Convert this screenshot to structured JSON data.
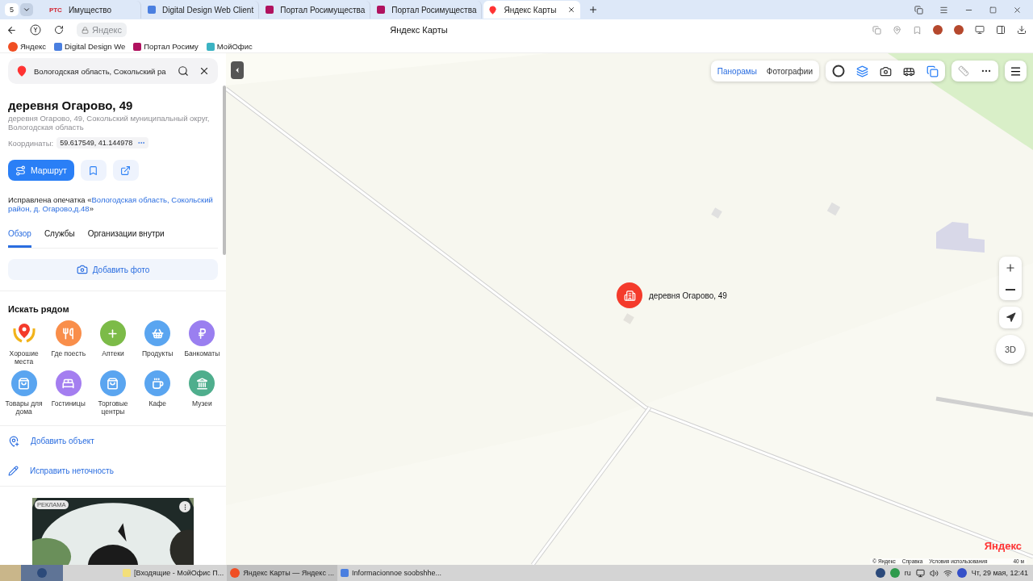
{
  "browser": {
    "tab_count": "5",
    "tabs": [
      {
        "label": "Имущество",
        "kind": "text",
        "icon_text": "РТС",
        "selected": false
      },
      {
        "label": "Digital Design Web Client",
        "kind": "doc",
        "selected": false
      },
      {
        "label": "Портал Росимущества",
        "kind": "portal",
        "selected": false
      },
      {
        "label": "Портал Росимущества",
        "kind": "portal",
        "selected": false
      },
      {
        "label": "Яндекс Карты",
        "kind": "pin",
        "selected": true
      }
    ],
    "address": "Яндекс",
    "page_title": "Яндекс Карты",
    "bookmarks": [
      {
        "label": "Яндекс",
        "kind": "yandex"
      },
      {
        "label": "Digital Design We",
        "kind": "doc"
      },
      {
        "label": "Портал Росиму",
        "kind": "portal"
      },
      {
        "label": "МойОфис",
        "kind": "office"
      }
    ]
  },
  "sidebar": {
    "search": {
      "value": "Вологодская область, Сокольский ра"
    },
    "place": {
      "title": "деревня Огарово, 49",
      "address": "деревня Огарово, 49, Сокольский муниципальный округ, Вологодская область",
      "coords_label": "Координаты:",
      "coords": "59.617549, 41.144978",
      "route_button": "Маршрут",
      "correction_prefix": "Исправлена опечатка «",
      "correction_link": "Вологодская область, Сокольский район, д. Огарово,д.48",
      "correction_suffix": "»"
    },
    "tabs": [
      {
        "label": "Обзор",
        "selected": true
      },
      {
        "label": "Службы",
        "selected": false
      },
      {
        "label": "Организации внутри",
        "selected": false
      }
    ],
    "add_photo": "Добавить фото",
    "nearby": {
      "title": "Искать рядом",
      "items": [
        {
          "label": "Хорошие места",
          "kind": "laurel"
        },
        {
          "label": "Где поесть",
          "kind": "food",
          "color": "#f98e4a"
        },
        {
          "label": "Аптеки",
          "kind": "pharmacy",
          "color": "#7cbb48"
        },
        {
          "label": "Продукты",
          "kind": "basket",
          "color": "#5aa5f0"
        },
        {
          "label": "Банкоматы",
          "kind": "ruble",
          "color": "#9a7ff0"
        },
        {
          "label": "Товары для дома",
          "kind": "bag",
          "color": "#5aa5f0"
        },
        {
          "label": "Гостиницы",
          "kind": "bed",
          "color": "#a47ef0"
        },
        {
          "label": "Торговые центры",
          "kind": "bag",
          "color": "#5aa5f0"
        },
        {
          "label": "Кафе",
          "kind": "cup",
          "color": "#5aa5f0"
        },
        {
          "label": "Музеи",
          "kind": "museum",
          "color": "#4fae8d"
        }
      ]
    },
    "actions": [
      {
        "label": "Добавить объект",
        "kind": "add"
      },
      {
        "label": "Исправить неточность",
        "kind": "edit"
      }
    ],
    "ad": {
      "label": "РЕКЛАМА",
      "kind": "picture"
    }
  },
  "map": {
    "layer_tabs": [
      {
        "label": "Панорамы",
        "selected": true
      },
      {
        "label": "Фотографии",
        "selected": false
      }
    ],
    "marker_label": "деревня Огарово, 49",
    "compass": "3D",
    "logo": "Яндекс",
    "footer": [
      "© Яндекс",
      "Справка",
      "Условия использования"
    ],
    "scale": "40 м"
  },
  "taskbar": {
    "windows": [
      {
        "label": "[Входящие - МойОфис П...",
        "kind": "mail",
        "selected": false
      },
      {
        "label": "Яндекс Карты — Яндекс ...",
        "kind": "yandex",
        "selected": true
      },
      {
        "label": "Informacionnoe soobshhe...",
        "kind": "doc",
        "selected": false
      }
    ],
    "language": "ru",
    "clock": "Чт, 29 мая, 12:41"
  }
}
